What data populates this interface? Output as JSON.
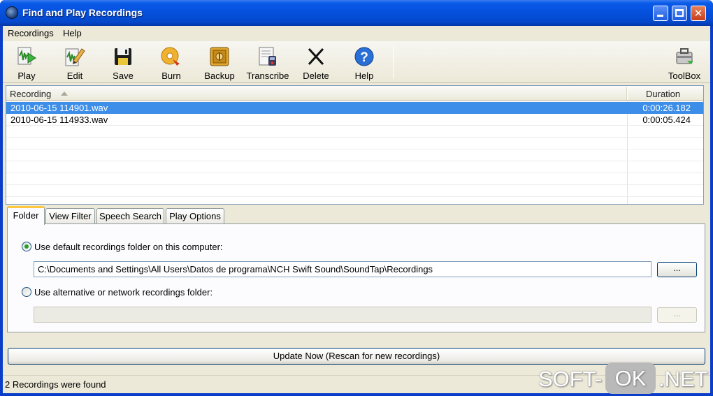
{
  "window": {
    "title": "Find and Play Recordings",
    "controls": {
      "minimize": "",
      "maximize": "",
      "close": "✕"
    }
  },
  "menu": [
    "Recordings",
    "Help"
  ],
  "toolbar": {
    "buttons": [
      {
        "label": "Play",
        "icon": "play-icon"
      },
      {
        "label": "Edit",
        "icon": "edit-icon"
      },
      {
        "label": "Save",
        "icon": "save-icon"
      },
      {
        "label": "Burn",
        "icon": "burn-icon"
      },
      {
        "label": "Backup",
        "icon": "backup-icon"
      },
      {
        "label": "Transcribe",
        "icon": "transcribe-icon"
      },
      {
        "label": "Delete",
        "icon": "delete-icon"
      },
      {
        "label": "Help",
        "icon": "help-icon"
      }
    ],
    "toolbox": {
      "label": "ToolBox",
      "icon": "toolbox-icon"
    }
  },
  "recordings": {
    "columns": {
      "recording": "Recording",
      "duration": "Duration"
    },
    "rows": [
      {
        "name": "2010-06-15 114901.wav",
        "duration": "0:00:26.182",
        "selected": true
      },
      {
        "name": "2010-06-15 114933.wav",
        "duration": "0:00:05.424",
        "selected": false
      }
    ]
  },
  "tabs": [
    "Folder",
    "View Filter",
    "Speech Search",
    "Play Options"
  ],
  "folder": {
    "default_option": "Use default recordings folder on this computer:",
    "default_path": "C:\\Documents and Settings\\All Users\\Datos de programa\\NCH Swift Sound\\SoundTap\\Recordings",
    "alternative_option": "Use alternative or network recordings folder:",
    "alternative_path": "",
    "browse_label": "...",
    "selected": "default"
  },
  "update_button": "Update Now (Rescan for new recordings)",
  "status": "2 Recordings were found",
  "watermark": {
    "left": "SOFT-",
    "mid": "OK",
    "right": ".NET"
  },
  "colors": {
    "titlebar": "#0550dc",
    "selection": "#3d8ee8",
    "tab_accent": "#ffc83c",
    "radio_dot": "#21a121"
  }
}
